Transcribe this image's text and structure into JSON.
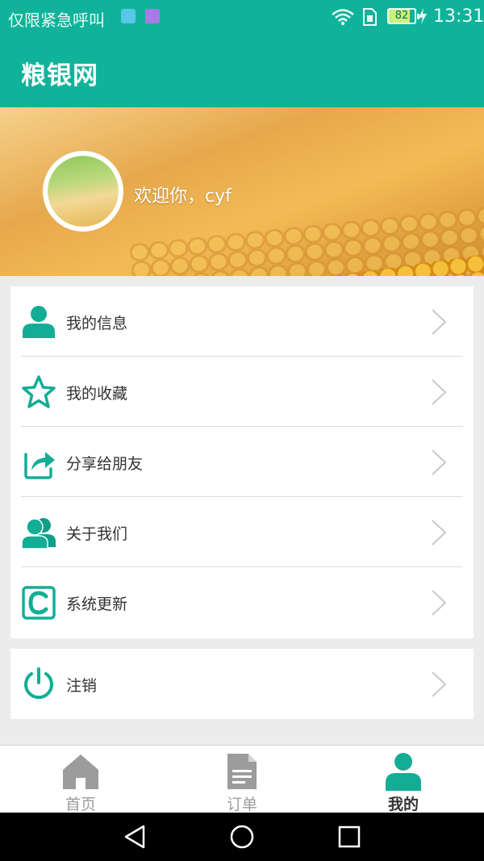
{
  "status_bar": {
    "carrier": "仅限紧急呼叫",
    "battery": "82",
    "time": "13:31"
  },
  "app_bar": {
    "title": "粮银网"
  },
  "profile": {
    "welcome": "欢迎你，cyf"
  },
  "menu": [
    {
      "label": "我的信息",
      "icon": "user-icon"
    },
    {
      "label": "我的收藏",
      "icon": "star-icon"
    },
    {
      "label": "分享给朋友",
      "icon": "share-icon"
    },
    {
      "label": "关于我们",
      "icon": "group-icon"
    },
    {
      "label": "系统更新",
      "icon": "update-c-icon"
    }
  ],
  "logout": {
    "label": "注销",
    "icon": "power-icon"
  },
  "bottom_nav": [
    {
      "label": "首页",
      "icon": "home-icon",
      "active": false
    },
    {
      "label": "订单",
      "icon": "document-icon",
      "active": false
    },
    {
      "label": "我的",
      "icon": "profile-icon",
      "active": true
    }
  ],
  "colors": {
    "primary": "#10b39a",
    "icon": "#13ad96",
    "inactive": "#9c9c9c"
  }
}
